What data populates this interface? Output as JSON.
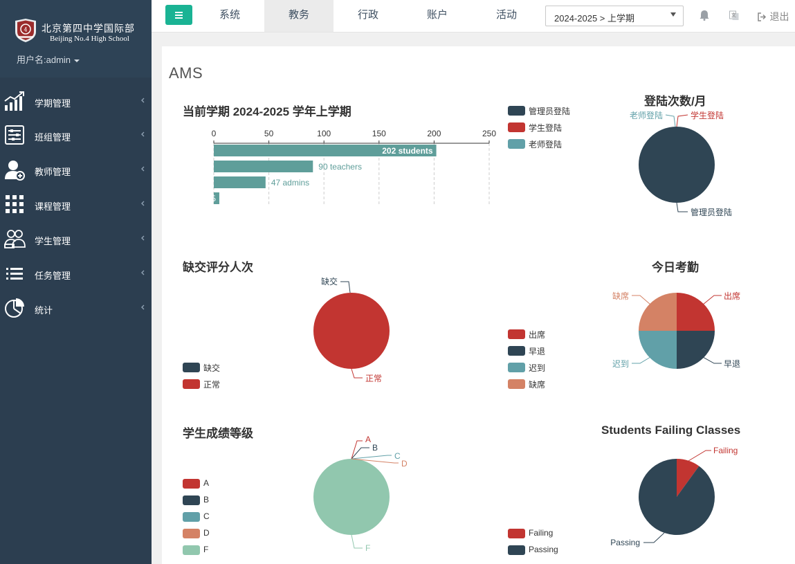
{
  "brand": {
    "school_cn": "北京第四中学国际部",
    "school_en": "Beijing No.4 High School",
    "user_label": "用户名:admin"
  },
  "sidebar": {
    "items": [
      {
        "label": "学期管理",
        "icon": "chart-growth-icon"
      },
      {
        "label": "班组管理",
        "icon": "sliders-icon"
      },
      {
        "label": "教师管理",
        "icon": "add-user-icon"
      },
      {
        "label": "课程管理",
        "icon": "grid-icon"
      },
      {
        "label": "学生管理",
        "icon": "users-icon"
      },
      {
        "label": "任务管理",
        "icon": "list-icon"
      },
      {
        "label": "统计",
        "icon": "pie-stats-icon"
      }
    ]
  },
  "topbar": {
    "tabs": [
      {
        "label": "系统",
        "active": false
      },
      {
        "label": "教务",
        "active": true
      },
      {
        "label": "行政",
        "active": false
      },
      {
        "label": "账户",
        "active": false
      },
      {
        "label": "活动",
        "active": false
      }
    ],
    "term_select": "2024-2025 > 上学期",
    "logout": "退出"
  },
  "main": {
    "app_title": "AMS"
  },
  "colors": {
    "sidebar": "#2c3e50",
    "accent": "#1ab394",
    "navy": "#2f4554",
    "red": "#c23531",
    "teal": "#61a0a8",
    "salmon": "#d48265",
    "mint": "#91c7ae"
  },
  "chart_data": [
    {
      "id": "term",
      "type": "bar",
      "orientation": "horizontal",
      "title": "当前学期  2024-2025 学年上学期",
      "x_ticks": [
        0,
        50,
        100,
        150,
        200,
        250
      ],
      "xlim": [
        0,
        250
      ],
      "bars": [
        {
          "value": 202,
          "label": "202 students"
        },
        {
          "value": 90,
          "label": "90 teachers"
        },
        {
          "value": 47,
          "label": "47 admins"
        },
        {
          "value": 5,
          "label": "5"
        }
      ],
      "legend": [
        "管理员登陆",
        "学生登陆",
        "老师登陆"
      ]
    },
    {
      "id": "logins",
      "type": "pie",
      "title": "登陆次数/月",
      "slices": [
        {
          "name": "管理员登陆",
          "value": 100,
          "color": "#2f4554"
        },
        {
          "name": "学生登陆",
          "value": 0,
          "color": "#c23531"
        },
        {
          "name": "老师登陆",
          "value": 0,
          "color": "#61a0a8"
        }
      ]
    },
    {
      "id": "absent",
      "type": "pie",
      "title": "缺交评分人次",
      "slices": [
        {
          "name": "缺交",
          "value": 0,
          "color": "#2f4554"
        },
        {
          "name": "正常",
          "value": 100,
          "color": "#c23531"
        }
      ],
      "legend": [
        "缺交",
        "正常"
      ]
    },
    {
      "id": "attendance",
      "type": "pie",
      "title": "今日考勤",
      "slices": [
        {
          "name": "出席",
          "value": 25,
          "color": "#c23531"
        },
        {
          "name": "早退",
          "value": 25,
          "color": "#2f4554"
        },
        {
          "name": "迟到",
          "value": 25,
          "color": "#61a0a8"
        },
        {
          "name": "缺席",
          "value": 25,
          "color": "#d48265"
        }
      ],
      "legend": [
        "出席",
        "早退",
        "迟到",
        "缺席"
      ]
    },
    {
      "id": "grades",
      "type": "pie",
      "title": "学生成绩等级",
      "slices": [
        {
          "name": "A",
          "value": 0,
          "color": "#c23531"
        },
        {
          "name": "B",
          "value": 0,
          "color": "#2f4554"
        },
        {
          "name": "C",
          "value": 0,
          "color": "#61a0a8"
        },
        {
          "name": "D",
          "value": 0,
          "color": "#d48265"
        },
        {
          "name": "F",
          "value": 100,
          "color": "#91c7ae"
        }
      ],
      "legend": [
        "A",
        "B",
        "C",
        "D",
        "F"
      ]
    },
    {
      "id": "failing",
      "type": "pie",
      "title": "Students Failing Classes",
      "slices": [
        {
          "name": "Failing",
          "value": 10,
          "color": "#c23531"
        },
        {
          "name": "Passing",
          "value": 90,
          "color": "#2f4554"
        }
      ],
      "legend": [
        "Failing",
        "Passing"
      ]
    }
  ]
}
